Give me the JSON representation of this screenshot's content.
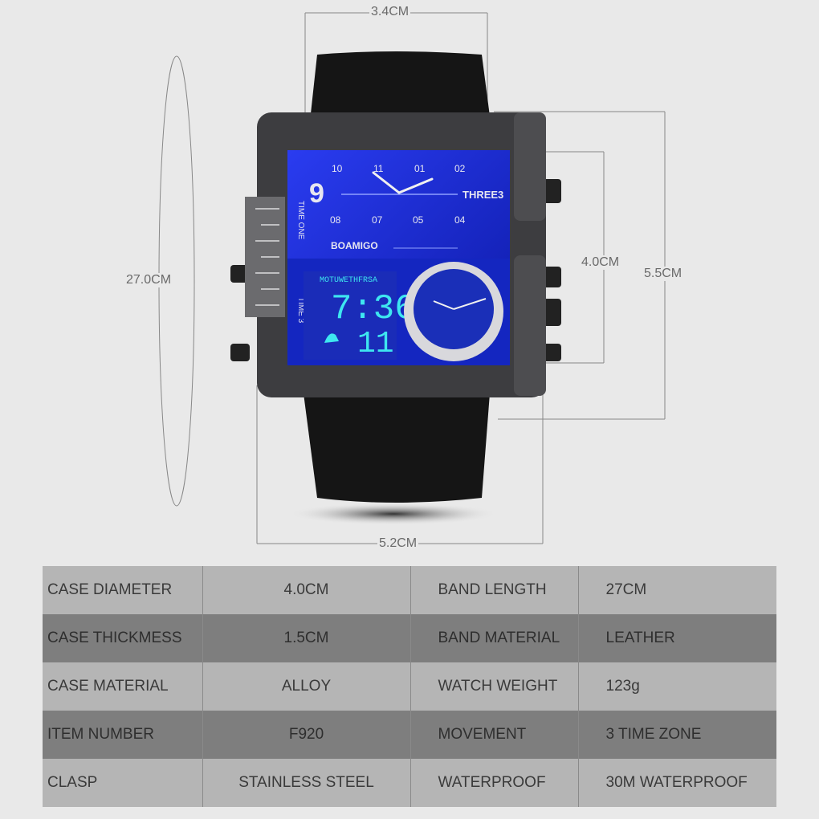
{
  "dimensions": {
    "width": "3.4CM",
    "band_length": "27.0CM",
    "case_height": "4.0CM",
    "total_height": "5.5CM",
    "case_width": "5.2CM"
  },
  "watch": {
    "brand": "BOAMIGO",
    "dial_numbers": [
      "10",
      "11",
      "01",
      "02",
      "08",
      "07",
      "05",
      "04"
    ],
    "big_numeral": "9",
    "label_three": "THREE3",
    "label_time_one": "TIME ONE",
    "label_time_3": "TIME 3",
    "digital_days": "MOTUWETHFRSA",
    "digital_time": "7:36",
    "digital_seconds": "11",
    "dial_color": "#1a2fd6",
    "lcd_color": "#3ee6f0"
  },
  "specs": {
    "rows": [
      [
        "CASE DIAMETER",
        "4.0CM",
        "BAND LENGTH",
        "27CM"
      ],
      [
        "CASE THICKMESS",
        "1.5CM",
        "BAND MATERIAL",
        "LEATHER"
      ],
      [
        "CASE MATERIAL",
        "ALLOY",
        "WATCH WEIGHT",
        "123g"
      ],
      [
        "ITEM NUMBER",
        "F920",
        "MOVEMENT",
        "3 TIME ZONE"
      ],
      [
        "CLASP",
        "STAINLESS STEEL",
        "WATERPROOF",
        "30M WATERPROOF"
      ]
    ],
    "colors": {
      "light_row": "#b5b5b5",
      "dark_row": "#7e7e7e"
    }
  }
}
